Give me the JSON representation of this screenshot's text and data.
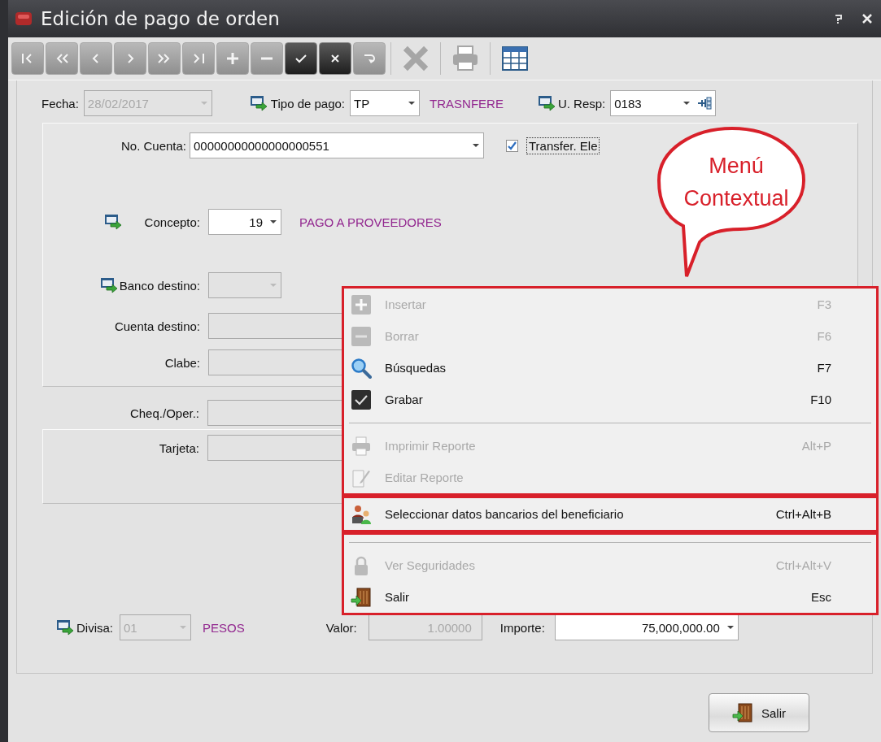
{
  "window": {
    "title": "Edición de pago de orden"
  },
  "toolbar": [
    {
      "kind": "boxed",
      "disabled": true
    },
    {
      "kind": "boxed",
      "disabled": true
    },
    {
      "kind": "boxed",
      "disabled": true
    },
    {
      "kind": "boxed",
      "disabled": true
    },
    {
      "kind": "boxed",
      "disabled": true
    },
    {
      "kind": "boxed",
      "disabled": true
    },
    {
      "kind": "boxed",
      "disabled": true
    },
    {
      "kind": "boxed",
      "disabled": true
    },
    {
      "kind": "boxed",
      "disabled": false
    },
    {
      "kind": "boxed",
      "disabled": false
    },
    {
      "kind": "boxed",
      "disabled": true
    },
    {
      "kind": "plain",
      "disabled": true
    },
    {
      "kind": "plain",
      "disabled": true
    },
    {
      "kind": "plain",
      "disabled": false
    }
  ],
  "fecha": {
    "label": "Fecha:",
    "value": "28/02/2017",
    "disabled": true
  },
  "tipo_pago": {
    "label": "Tipo de pago:",
    "value": "TP",
    "disabled": false,
    "description": "TRASNFERE"
  },
  "u_resp": {
    "label": "U. Resp:",
    "value": "0183",
    "disabled": false
  },
  "no_cuenta": {
    "label": "No. Cuenta:",
    "value": "00000000000000000551",
    "disabled": false
  },
  "transfer": {
    "label": "Transfer. Ele",
    "checked": true
  },
  "concepto": {
    "label": "Concepto:",
    "value": "19",
    "disabled": false,
    "description": "PAGO A PROVEEDORES"
  },
  "banco_destino": {
    "label": "Banco destino:",
    "disabled": true
  },
  "cuenta_destino": {
    "label": "Cuenta destino:",
    "disabled": true
  },
  "clabe": {
    "label": "Clabe:",
    "disabled": true
  },
  "cheq_oper": {
    "label": "Cheq./Oper.:",
    "disabled": true
  },
  "tarjeta": {
    "label": "Tarjeta:",
    "disabled": true
  },
  "divisa": {
    "label": "Divisa:",
    "value": "01",
    "disabled": true,
    "description": "PESOS"
  },
  "valor": {
    "label": "Valor:",
    "value": "1.00000",
    "disabled": true
  },
  "importe": {
    "label": "Importe:",
    "value": "75,000,000.00",
    "disabled": false
  },
  "context_menu": {
    "sections": [
      {
        "highlighted": true,
        "items": [
          {
            "kind": "item",
            "label": "Insertar",
            "shortcut": "F3",
            "disabled": true
          },
          {
            "kind": "item",
            "label": "Borrar",
            "shortcut": "F6",
            "disabled": true
          },
          {
            "kind": "item",
            "label": "Búsquedas",
            "shortcut": "F7",
            "disabled": false
          },
          {
            "kind": "item",
            "label": "Grabar",
            "shortcut": "F10",
            "disabled": false
          },
          {
            "kind": "separator"
          },
          {
            "kind": "item",
            "label": "Imprimir Reporte",
            "shortcut": "Alt+P",
            "disabled": true
          },
          {
            "kind": "item",
            "label": "Editar Reporte",
            "disabled": true
          }
        ]
      },
      {
        "highlighted": true,
        "items": [
          {
            "kind": "item",
            "label": "Seleccionar datos bancarios del beneficiario",
            "shortcut": "Ctrl+Alt+B",
            "disabled": false
          }
        ]
      },
      {
        "highlighted": true,
        "items": [
          {
            "kind": "separator"
          },
          {
            "kind": "item",
            "label": "Ver Seguridades",
            "shortcut": "Ctrl+Alt+V",
            "disabled": true
          },
          {
            "kind": "item",
            "label": "Salir",
            "shortcut": "Esc",
            "disabled": false
          }
        ]
      }
    ]
  },
  "callout": {
    "text": "Menú Contextual"
  },
  "exit_button": {
    "label": "Salir"
  }
}
